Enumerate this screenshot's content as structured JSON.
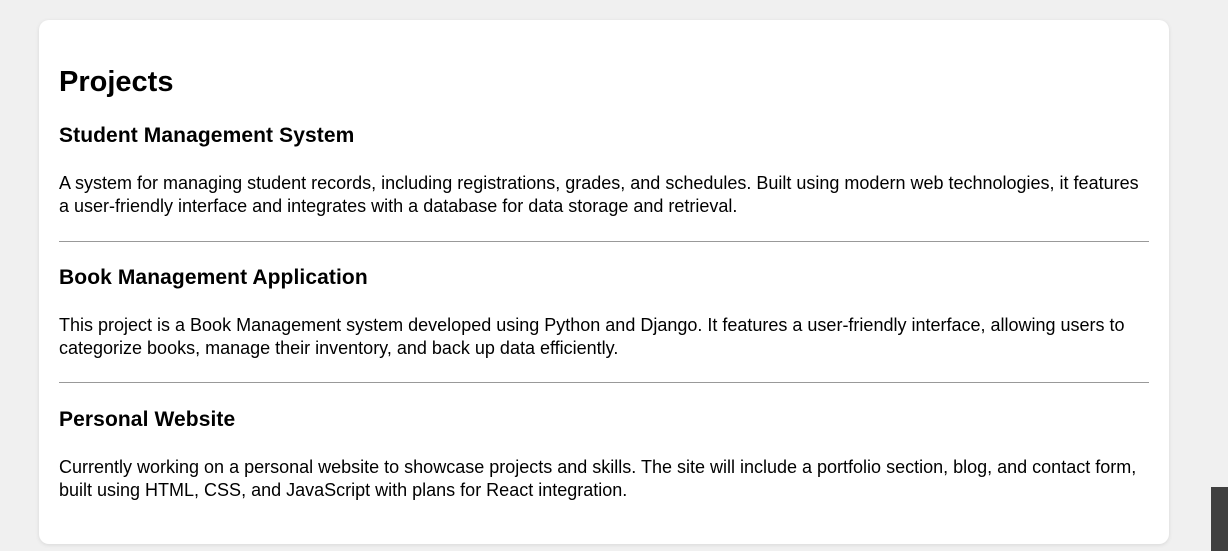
{
  "page": {
    "title": "Projects"
  },
  "projects": [
    {
      "name": "Student Management System",
      "description": "A system for managing student records, including registrations, grades, and schedules. Built using modern web technologies, it features a user-friendly interface and integrates with a database for data storage and retrieval."
    },
    {
      "name": "Book Management Application",
      "description": "This project is a Book Management system developed using Python and Django. It features a user-friendly interface, allowing users to categorize books, manage their inventory, and back up data efficiently."
    },
    {
      "name": "Personal Website",
      "description": "Currently working on a personal website to showcase projects and skills. The site will include a portfolio section, blog, and contact form, built using HTML, CSS, and JavaScript with plans for React integration."
    }
  ],
  "colors": {
    "page_background": "#f0f0f0",
    "card_background": "#ffffff",
    "divider": "#999999",
    "scrollbar_thumb": "#404040"
  }
}
